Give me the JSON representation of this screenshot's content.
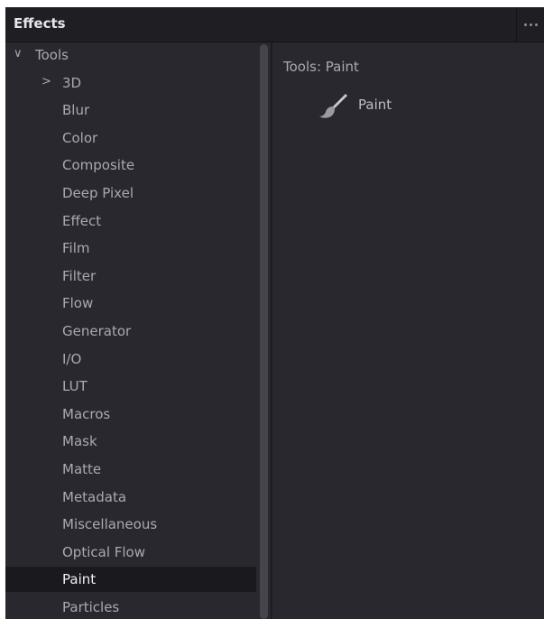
{
  "header": {
    "title": "Effects",
    "menu_icon": "more-dots-icon"
  },
  "tree": {
    "root": {
      "label": "Tools",
      "expanded": true,
      "icon": "chevron-down-icon"
    },
    "items": [
      {
        "label": "3D",
        "has_children": true,
        "icon": "chevron-right-icon"
      },
      {
        "label": "Blur"
      },
      {
        "label": "Color"
      },
      {
        "label": "Composite"
      },
      {
        "label": "Deep Pixel"
      },
      {
        "label": "Effect"
      },
      {
        "label": "Film"
      },
      {
        "label": "Filter"
      },
      {
        "label": "Flow"
      },
      {
        "label": "Generator"
      },
      {
        "label": "I/O"
      },
      {
        "label": "LUT"
      },
      {
        "label": "Macros"
      },
      {
        "label": "Mask"
      },
      {
        "label": "Matte"
      },
      {
        "label": "Metadata"
      },
      {
        "label": "Miscellaneous"
      },
      {
        "label": "Optical Flow"
      },
      {
        "label": "Paint",
        "selected": true
      },
      {
        "label": "Particles"
      }
    ]
  },
  "content": {
    "path": "Tools: Paint",
    "tools": [
      {
        "label": "Paint",
        "icon": "paintbrush-icon"
      }
    ]
  },
  "colors": {
    "panel_bg": "#28282e",
    "header_bg": "#1f1f23",
    "selected_bg": "#1a1a1e",
    "text": "#a9a9af",
    "selected_text": "#f0f0f2"
  }
}
